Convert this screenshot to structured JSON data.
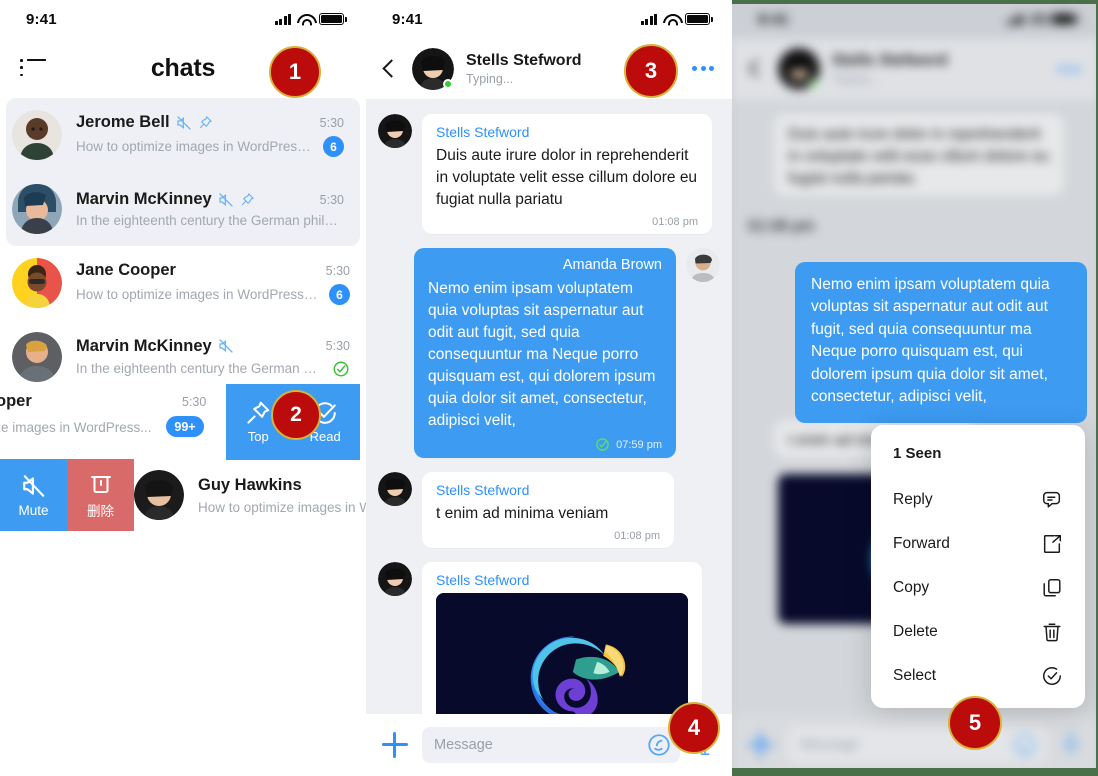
{
  "status_bar": {
    "time": "9:41"
  },
  "left_panel": {
    "title": "chats",
    "menu_icon": "list-menu-icon",
    "chat_items": [
      {
        "name": "Jerome Bell",
        "preview": "How to optimize images in WordPress for...",
        "time": "5:30",
        "badge": "6",
        "muted": true,
        "pinned": true,
        "highlight": true
      },
      {
        "name": "Marvin McKinney",
        "preview": "In the eighteenth century the German philosoph...",
        "time": "5:30",
        "badge": "",
        "muted": true,
        "pinned": true,
        "highlight": true
      },
      {
        "name": "Jane Cooper",
        "preview": "How to optimize images in WordPress for...",
        "time": "5:30",
        "badge": "6",
        "muted": false,
        "pinned": false,
        "highlight": false
      },
      {
        "name": "Marvin McKinney",
        "preview": "In the eighteenth century the German philos...",
        "time": "5:30",
        "badge": "",
        "read_check": true,
        "muted": true,
        "pinned": false,
        "highlight": false
      }
    ],
    "partial_row": {
      "name": "oper",
      "preview": "mize images in WordPress...",
      "time": "5:30",
      "badge": "99+"
    },
    "guy_row": {
      "name": "Guy Hawkins",
      "preview": "How to optimize images in W"
    },
    "swipe_right_actions": [
      {
        "label": "Top",
        "icon": "pin-icon"
      },
      {
        "label": "Read",
        "icon": "check-circle-icon"
      }
    ],
    "swipe_left_actions": [
      {
        "label": "Mute",
        "icon": "mute-icon",
        "color": "#3d9bf1"
      },
      {
        "label": "删除",
        "icon": "trash-icon",
        "color": "#d96a6a"
      }
    ]
  },
  "mid_panel": {
    "header": {
      "name": "Stells Stefword",
      "status": "Typing...",
      "back_icon": "back-chevron-icon",
      "more_icon": "more-horizontal-icon"
    },
    "messages": [
      {
        "direction": "in",
        "sender": "Stells Stefword",
        "text": "Duis aute irure dolor in reprehenderit in voluptate velit esse cillum dolore eu fugiat nulla pariatu",
        "time": "01:08 pm"
      },
      {
        "direction": "out",
        "sender": "Amanda Brown",
        "text": "Nemo enim ipsam voluptatem quia voluptas sit aspernatur aut odit aut fugit, sed quia consequuntur ma Neque porro quisquam est, qui dolorem ipsum quia dolor sit amet, consectetur, adipisci velit,",
        "time": "07:59 pm",
        "read": true
      },
      {
        "direction": "in",
        "sender": "Stells Stefword",
        "text": "t enim ad minima veniam",
        "time": "01:08 pm"
      },
      {
        "direction": "in",
        "sender": "Stells Stefword",
        "type": "image",
        "alt": "chameleon-logo-image"
      }
    ],
    "composer": {
      "plus_icon": "plus-icon",
      "placeholder": "Message",
      "emoji_icon": "emoji-icon",
      "mic_icon": "microphone-icon"
    }
  },
  "right_panel": {
    "focused_message": {
      "text": "Nemo enim ipsam voluptatem quia voluptas sit aspernatur aut odit aut fugit, sed quia consequuntur ma Neque porro quisquam est, qui dolorem ipsum quia dolor sit amet, consectetur, adipisci velit,"
    },
    "context_menu": {
      "seen_label": "1 Seen",
      "items": [
        {
          "label": "Reply",
          "icon": "reply-icon"
        },
        {
          "label": "Forward",
          "icon": "forward-icon"
        },
        {
          "label": "Copy",
          "icon": "copy-icon"
        },
        {
          "label": "Delete",
          "icon": "trash-icon"
        },
        {
          "label": "Select",
          "icon": "check-circle-icon"
        }
      ]
    }
  },
  "step_badges": [
    {
      "number": "1"
    },
    {
      "number": "2"
    },
    {
      "number": "3"
    },
    {
      "number": "4"
    },
    {
      "number": "5"
    }
  ],
  "colors": {
    "accent_blue": "#2e90fa",
    "bubble_blue": "#3d9bf1",
    "badge_red": "#bb0b0b",
    "badge_border_gold": "#d8b23a",
    "delete_red": "#d96a6a",
    "read_green": "#3cc13b",
    "chat_bg": "#eef0f4"
  }
}
